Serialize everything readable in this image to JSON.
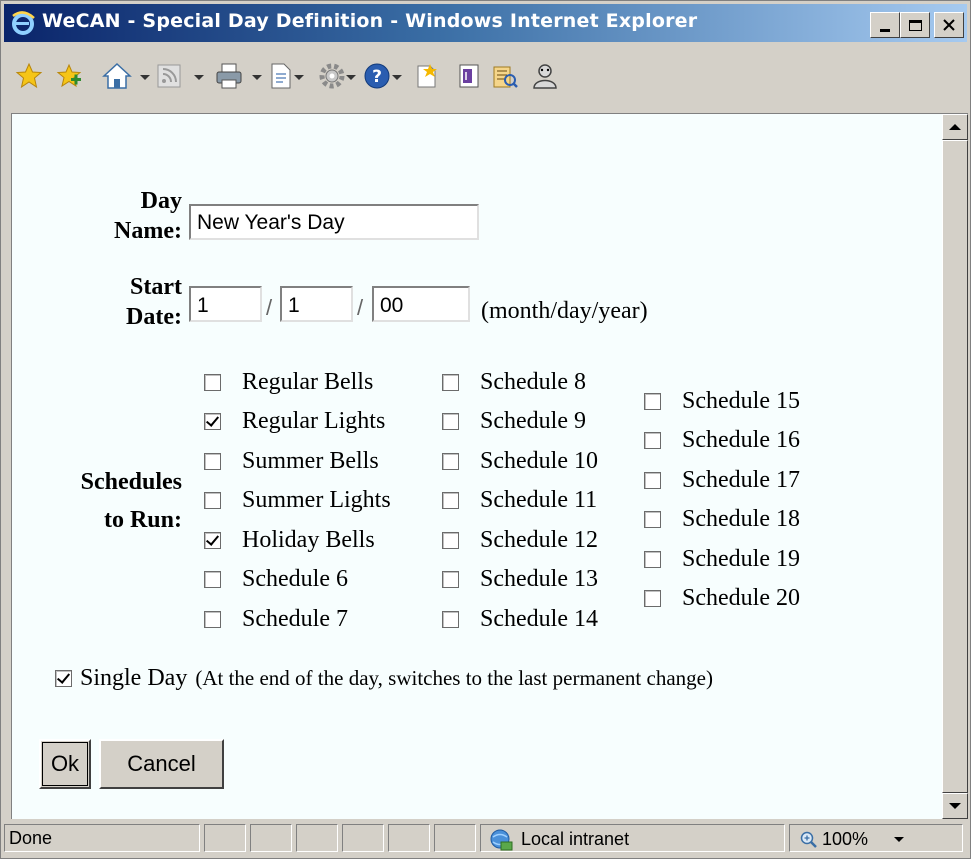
{
  "window": {
    "title": "WeCAN - Special Day Definition - Windows Internet Explorer"
  },
  "form": {
    "day_name_label_1": "Day",
    "day_name_label_2": "Name:",
    "day_name_value": "New Year's Day",
    "start_date_label_1": "Start",
    "start_date_label_2": "Date:",
    "month_value": "1",
    "day_value": "1",
    "year_value": "00",
    "date_separator": "/",
    "date_hint": "(month/day/year)",
    "schedules_label_1": "Schedules",
    "schedules_label_2": "to Run:",
    "schedules_col1": [
      {
        "label": "Regular Bells",
        "checked": false
      },
      {
        "label": "Regular Lights",
        "checked": true
      },
      {
        "label": "Summer Bells",
        "checked": false
      },
      {
        "label": "Summer Lights",
        "checked": false
      },
      {
        "label": "Holiday Bells",
        "checked": true
      },
      {
        "label": "Schedule 6",
        "checked": false
      },
      {
        "label": "Schedule 7",
        "checked": false
      }
    ],
    "schedules_col2": [
      {
        "label": "Schedule 8",
        "checked": false
      },
      {
        "label": "Schedule 9",
        "checked": false
      },
      {
        "label": "Schedule 10",
        "checked": false
      },
      {
        "label": "Schedule 11",
        "checked": false
      },
      {
        "label": "Schedule 12",
        "checked": false
      },
      {
        "label": "Schedule 13",
        "checked": false
      },
      {
        "label": "Schedule 14",
        "checked": false
      }
    ],
    "schedules_col3": [
      {
        "label": "Schedule 15",
        "checked": false
      },
      {
        "label": "Schedule 16",
        "checked": false
      },
      {
        "label": "Schedule 17",
        "checked": false
      },
      {
        "label": "Schedule 18",
        "checked": false
      },
      {
        "label": "Schedule 19",
        "checked": false
      },
      {
        "label": "Schedule 20",
        "checked": false
      }
    ],
    "single_day_label": "Single Day",
    "single_day_note": "(At the end of the day, switches to the last permanent change)",
    "single_day_checked": true,
    "ok_label": "Ok",
    "cancel_label": "Cancel"
  },
  "statusbar": {
    "status_text": "Done",
    "zone_text": "Local intranet",
    "zoom_text": "100%"
  }
}
